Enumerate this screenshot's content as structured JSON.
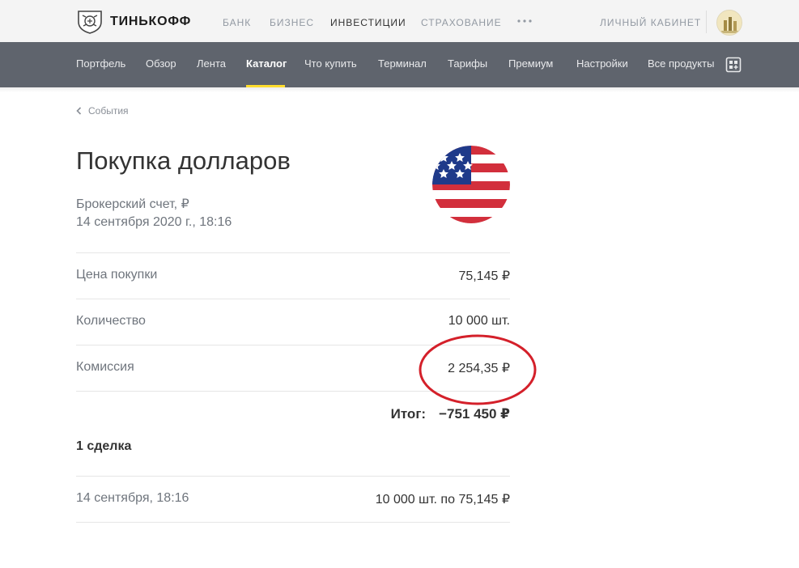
{
  "brand": {
    "name": "ТИНЬКОФФ"
  },
  "top_nav": {
    "items": [
      {
        "label": "БАНК",
        "active": false
      },
      {
        "label": "БИЗНЕС",
        "active": false
      },
      {
        "label": "ИНВЕСТИЦИИ",
        "active": true
      },
      {
        "label": "СТРАХОВАНИЕ",
        "active": false
      }
    ],
    "more_icon": "more-dots-icon",
    "login_label": "ЛИЧНЫЙ КАБИНЕТ"
  },
  "sub_nav": {
    "items": [
      {
        "label": "Портфель",
        "active": false
      },
      {
        "label": "Обзор",
        "active": false
      },
      {
        "label": "Лента",
        "active": false
      },
      {
        "label": "Каталог",
        "active": true
      },
      {
        "label": "Что купить",
        "active": false
      },
      {
        "label": "Терминал",
        "active": false
      },
      {
        "label": "Тарифы",
        "active": false
      },
      {
        "label": "Премиум",
        "active": false
      },
      {
        "label": "Настройки",
        "active": false
      },
      {
        "label": "Все продукты",
        "active": false
      }
    ],
    "products_icon": "grid-plus-icon"
  },
  "breadcrumb": {
    "label": "События"
  },
  "operation": {
    "title": "Покупка долларов",
    "account": "Брокерский счет, ₽",
    "datetime": "14 сентября 2020 г., 18:16",
    "icon": "us-flag-icon"
  },
  "details": [
    {
      "label": "Цена покупки",
      "value": "75,145 ₽"
    },
    {
      "label": "Количество",
      "value": "10 000 шт."
    },
    {
      "label": "Комиссия",
      "value": "2 254,35 ₽"
    }
  ],
  "total": {
    "label": "Итог:",
    "value": "−751 450 ₽"
  },
  "deals": {
    "heading": "1 сделка",
    "items": [
      {
        "datetime": "14 сентября, 18:16",
        "summary": "10 000 шт. по 75,145 ₽"
      }
    ]
  },
  "colors": {
    "accent": "#ffdd2d",
    "subnav_bg": "#5f646d",
    "annotation": "#d4202a"
  }
}
